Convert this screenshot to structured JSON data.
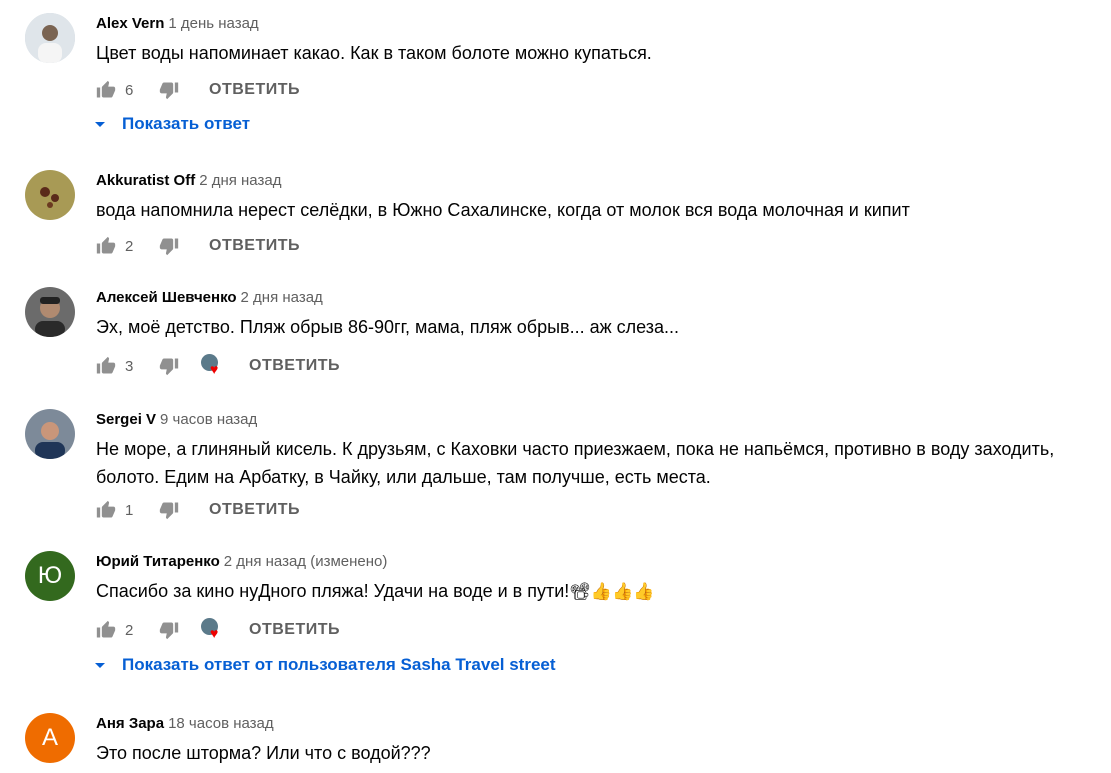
{
  "comments": [
    {
      "author": "Alex Vern",
      "time": "1 день назад",
      "text": "Цвет воды напоминает какао. Как в таком болоте можно купаться.",
      "likes": "6",
      "reply": "ОТВЕТИТЬ",
      "show_replies": "Показать ответ",
      "avatar_color": "#c9d3dc"
    },
    {
      "author": "Akkuratist Off",
      "time": "2 дня назад",
      "text": "вода напомнила нерест селёдки, в Южно Сахалинске, когда от молок вся вода молочная  и кипит",
      "likes": "2",
      "reply": "ОТВЕТИТЬ",
      "avatar_color": "#8b7a3a"
    },
    {
      "author": "Алексей Шевченко",
      "time": "2 дня назад",
      "text": "Эх, моё детство. Пляж обрыв 86-90гг, мама, пляж обрыв... аж слеза...",
      "likes": "3",
      "reply": "ОТВЕТИТЬ",
      "avatar_color": "#4a4a4a"
    },
    {
      "author": "Sergei V",
      "time": "9 часов назад",
      "text": "Не море, а глиняный кисель. К друзьям, с Каховки часто приезжаем, пока не напьёмся, противно в воду заходить, болото. Едим на Арбатку, в Чайку, или дальше, там получше, есть места.",
      "likes": "1",
      "reply": "ОТВЕТИТЬ",
      "avatar_color": "#3b4a63"
    },
    {
      "author": "Юрий Титаренко",
      "time": "2 дня назад (изменено)",
      "text": "Спасибо за кино нуДного пляжа! Удачи на воде и в пути!",
      "emoji": "📽👍👍👍",
      "likes": "2",
      "reply": "ОТВЕТИТЬ",
      "show_replies": "Показать ответ от пользователя Sasha Travel street",
      "avatar_letter": "Ю",
      "avatar_color": "#33691e"
    },
    {
      "author": "Аня Зара",
      "time": "18 часов назад",
      "text": "Это после шторма? Или что с водой???",
      "avatar_letter": "А",
      "avatar_color": "#ef6c00"
    }
  ]
}
